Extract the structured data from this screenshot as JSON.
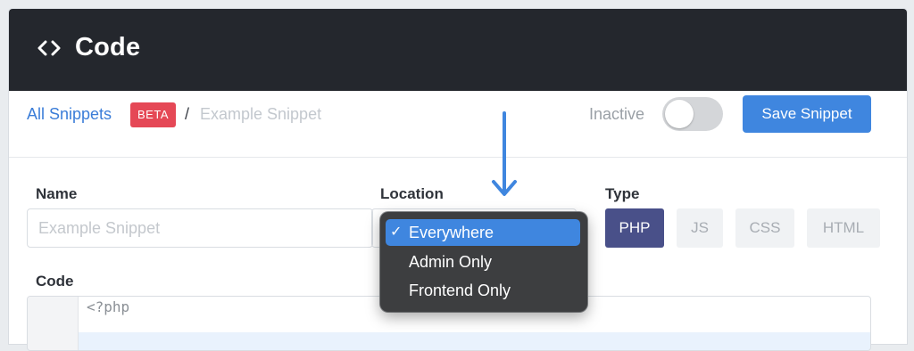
{
  "header": {
    "icon": "code-icon",
    "title": "Code"
  },
  "breadcrumb": {
    "link": "All Snippets",
    "badge": "BETA",
    "separator": "/",
    "current": "Example Snippet"
  },
  "status": {
    "label": "Inactive",
    "active": false
  },
  "save_label": "Save Snippet",
  "form": {
    "name_label": "Name",
    "name_placeholder": "Example Snippet",
    "location_label": "Location",
    "type_label": "Type",
    "types": [
      "PHP",
      "JS",
      "CSS",
      "HTML"
    ],
    "selected_type": "PHP",
    "code_label": "Code",
    "code_first_line": "<?php"
  },
  "dropdown": {
    "check": "✓",
    "options": [
      "Everywhere",
      "Admin Only",
      "Frontend Only"
    ],
    "selected": "Everywhere"
  },
  "colors": {
    "accent": "#3f86df",
    "header": "#24272d",
    "badge": "#e54856",
    "type_active": "#495089"
  }
}
